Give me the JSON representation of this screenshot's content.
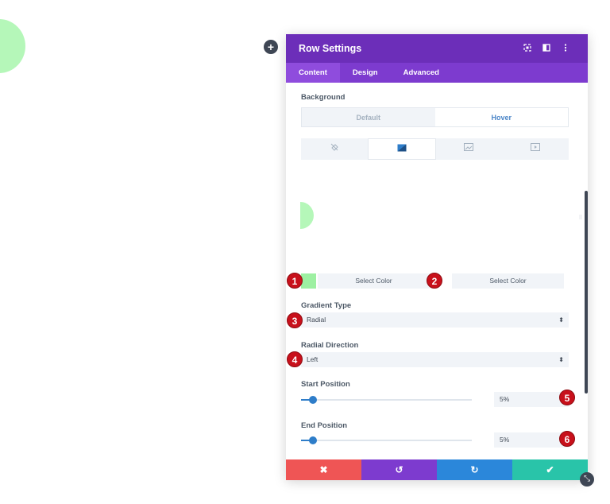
{
  "panel": {
    "title": "Row Settings",
    "header_icons": [
      "focus-icon",
      "split-view-icon",
      "more-icon"
    ],
    "tabs": [
      {
        "label": "Content",
        "active": true
      },
      {
        "label": "Design",
        "active": false
      },
      {
        "label": "Advanced",
        "active": false
      }
    ]
  },
  "background": {
    "label": "Background",
    "mode_default": "Default",
    "mode_hover": "Hover",
    "active_mode": "Hover",
    "type_tabs": [
      "color-icon",
      "gradient-icon",
      "image-icon",
      "video-icon"
    ],
    "active_type": "gradient-icon"
  },
  "gradient": {
    "start_color": "#9df0a2",
    "select_color_1": "Select Color",
    "select_color_2": "Select Color",
    "type_label": "Gradient Type",
    "type_value": "Radial",
    "direction_label": "Radial Direction",
    "direction_value": "Left",
    "start_label": "Start Position",
    "start_value": "5%",
    "end_label": "End Position",
    "end_value": "5%"
  },
  "markers": [
    "1",
    "2",
    "3",
    "4",
    "5",
    "6"
  ],
  "footer": {
    "cancel": "✖",
    "undo": "↺",
    "redo": "↻",
    "save": "✔"
  },
  "colors": {
    "header": "#6c2eb9",
    "tabs": "#7d3bcf",
    "cancel": "#ef5555",
    "undo": "#7d3bcf",
    "redo": "#2b87da",
    "save": "#29c4a9",
    "accent": "#2e7dc9",
    "marker": "#c8101b"
  }
}
